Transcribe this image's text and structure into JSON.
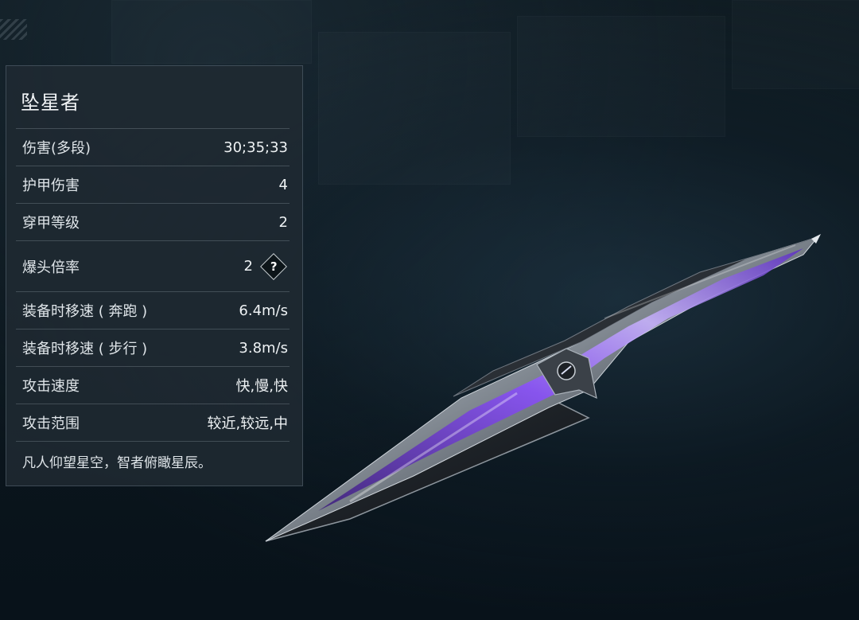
{
  "weapon": {
    "name": "坠星者",
    "stats": [
      {
        "label": "伤害(多段)",
        "value": "30;35;33"
      },
      {
        "label": "护甲伤害",
        "value": "4"
      },
      {
        "label": "穿甲等级",
        "value": "2"
      },
      {
        "label": "爆头倍率",
        "value": "2"
      },
      {
        "label": "装备时移速 ( 奔跑 )",
        "value": "6.4m/s"
      },
      {
        "label": "装备时移速 ( 步行 )",
        "value": "3.8m/s"
      },
      {
        "label": "攻击速度",
        "value": "快,慢,快"
      },
      {
        "label": "攻击范围",
        "value": "较近,较远,中"
      }
    ],
    "help_symbol": "?",
    "flavor_text": "凡人仰望星空，智者俯瞰星辰。"
  },
  "icons": {
    "help": "question-diamond-icon",
    "corner": "corner-stripes-icon"
  },
  "colors": {
    "background": "#0b161d",
    "panel": "#202a32",
    "blade_accent": "#8a4dff",
    "blade_steel": "#b8bec6"
  }
}
